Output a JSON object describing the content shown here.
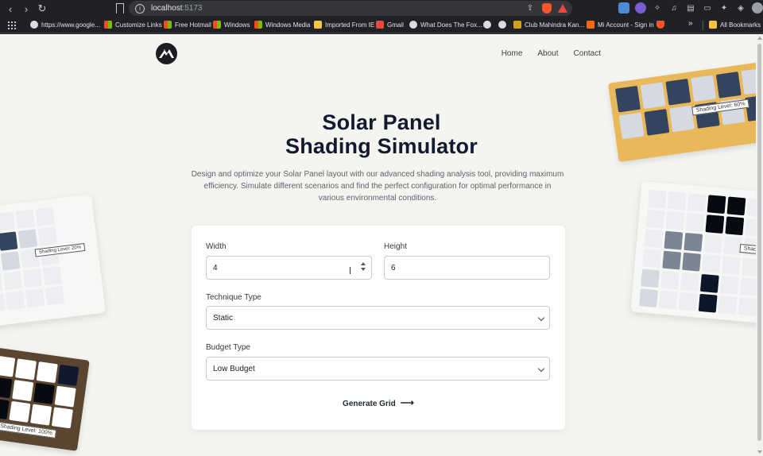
{
  "browser": {
    "url_host": "localhost",
    "url_port": ":5173",
    "bookmarks": [
      {
        "label": "https://www.google...",
        "icon": "globe-icon"
      },
      {
        "label": "Customize Links",
        "icon": "ms-icon"
      },
      {
        "label": "Free Hotmail",
        "icon": "ms-icon"
      },
      {
        "label": "Windows",
        "icon": "ms-icon"
      },
      {
        "label": "Windows Media",
        "icon": "ms-icon"
      },
      {
        "label": "Imported From IE",
        "icon": "folder-icon"
      },
      {
        "label": "Gmail",
        "icon": "gmail-icon"
      },
      {
        "label": "What Does The Fox...",
        "icon": "globe-icon"
      },
      {
        "label": "",
        "icon": "globe-icon"
      },
      {
        "label": "",
        "icon": "globe-icon"
      },
      {
        "label": "Club Mahindra Kan...",
        "icon": "club-icon"
      },
      {
        "label": "Mi Account - Sign in",
        "icon": "mi-icon"
      },
      {
        "label": "",
        "icon": "brave-icon"
      }
    ],
    "more_label": "»",
    "all_bookmarks": "All Bookmarks"
  },
  "nav": {
    "items": [
      "Home",
      "About",
      "Contact"
    ]
  },
  "hero": {
    "title_line1": "Solar Panel",
    "title_line2": "Shading Simulator",
    "subtitle": "Design and optimize your Solar Panel layout with our advanced shading analysis tool, providing maximum efficiency. Simulate different scenarios and find the perfect configuration for optimal performance in various environmental conditions."
  },
  "form": {
    "width_label": "Width",
    "width_value": "4",
    "height_label": "Height",
    "height_value": "6",
    "technique_label": "Technique Type",
    "technique_value": "Static",
    "budget_label": "Budget Type",
    "budget_value": "Low Budget",
    "generate_label": "Generate Grid",
    "generate_arrow": "⟶"
  },
  "panels": {
    "top_right_tag": "Shading Level: 60%",
    "left_tag": "Shading Level: 20%",
    "bottom_left_tag": "Shading Level: 100%",
    "right_tag": "Shadi"
  },
  "colors": {
    "page_bg": "#f4f4f1",
    "title": "#111a2e",
    "panel_gold": "#e8b85a",
    "panel_brown": "#5a4530",
    "cell_dark": "#34435e",
    "cell_light": "#d4d9e2"
  }
}
